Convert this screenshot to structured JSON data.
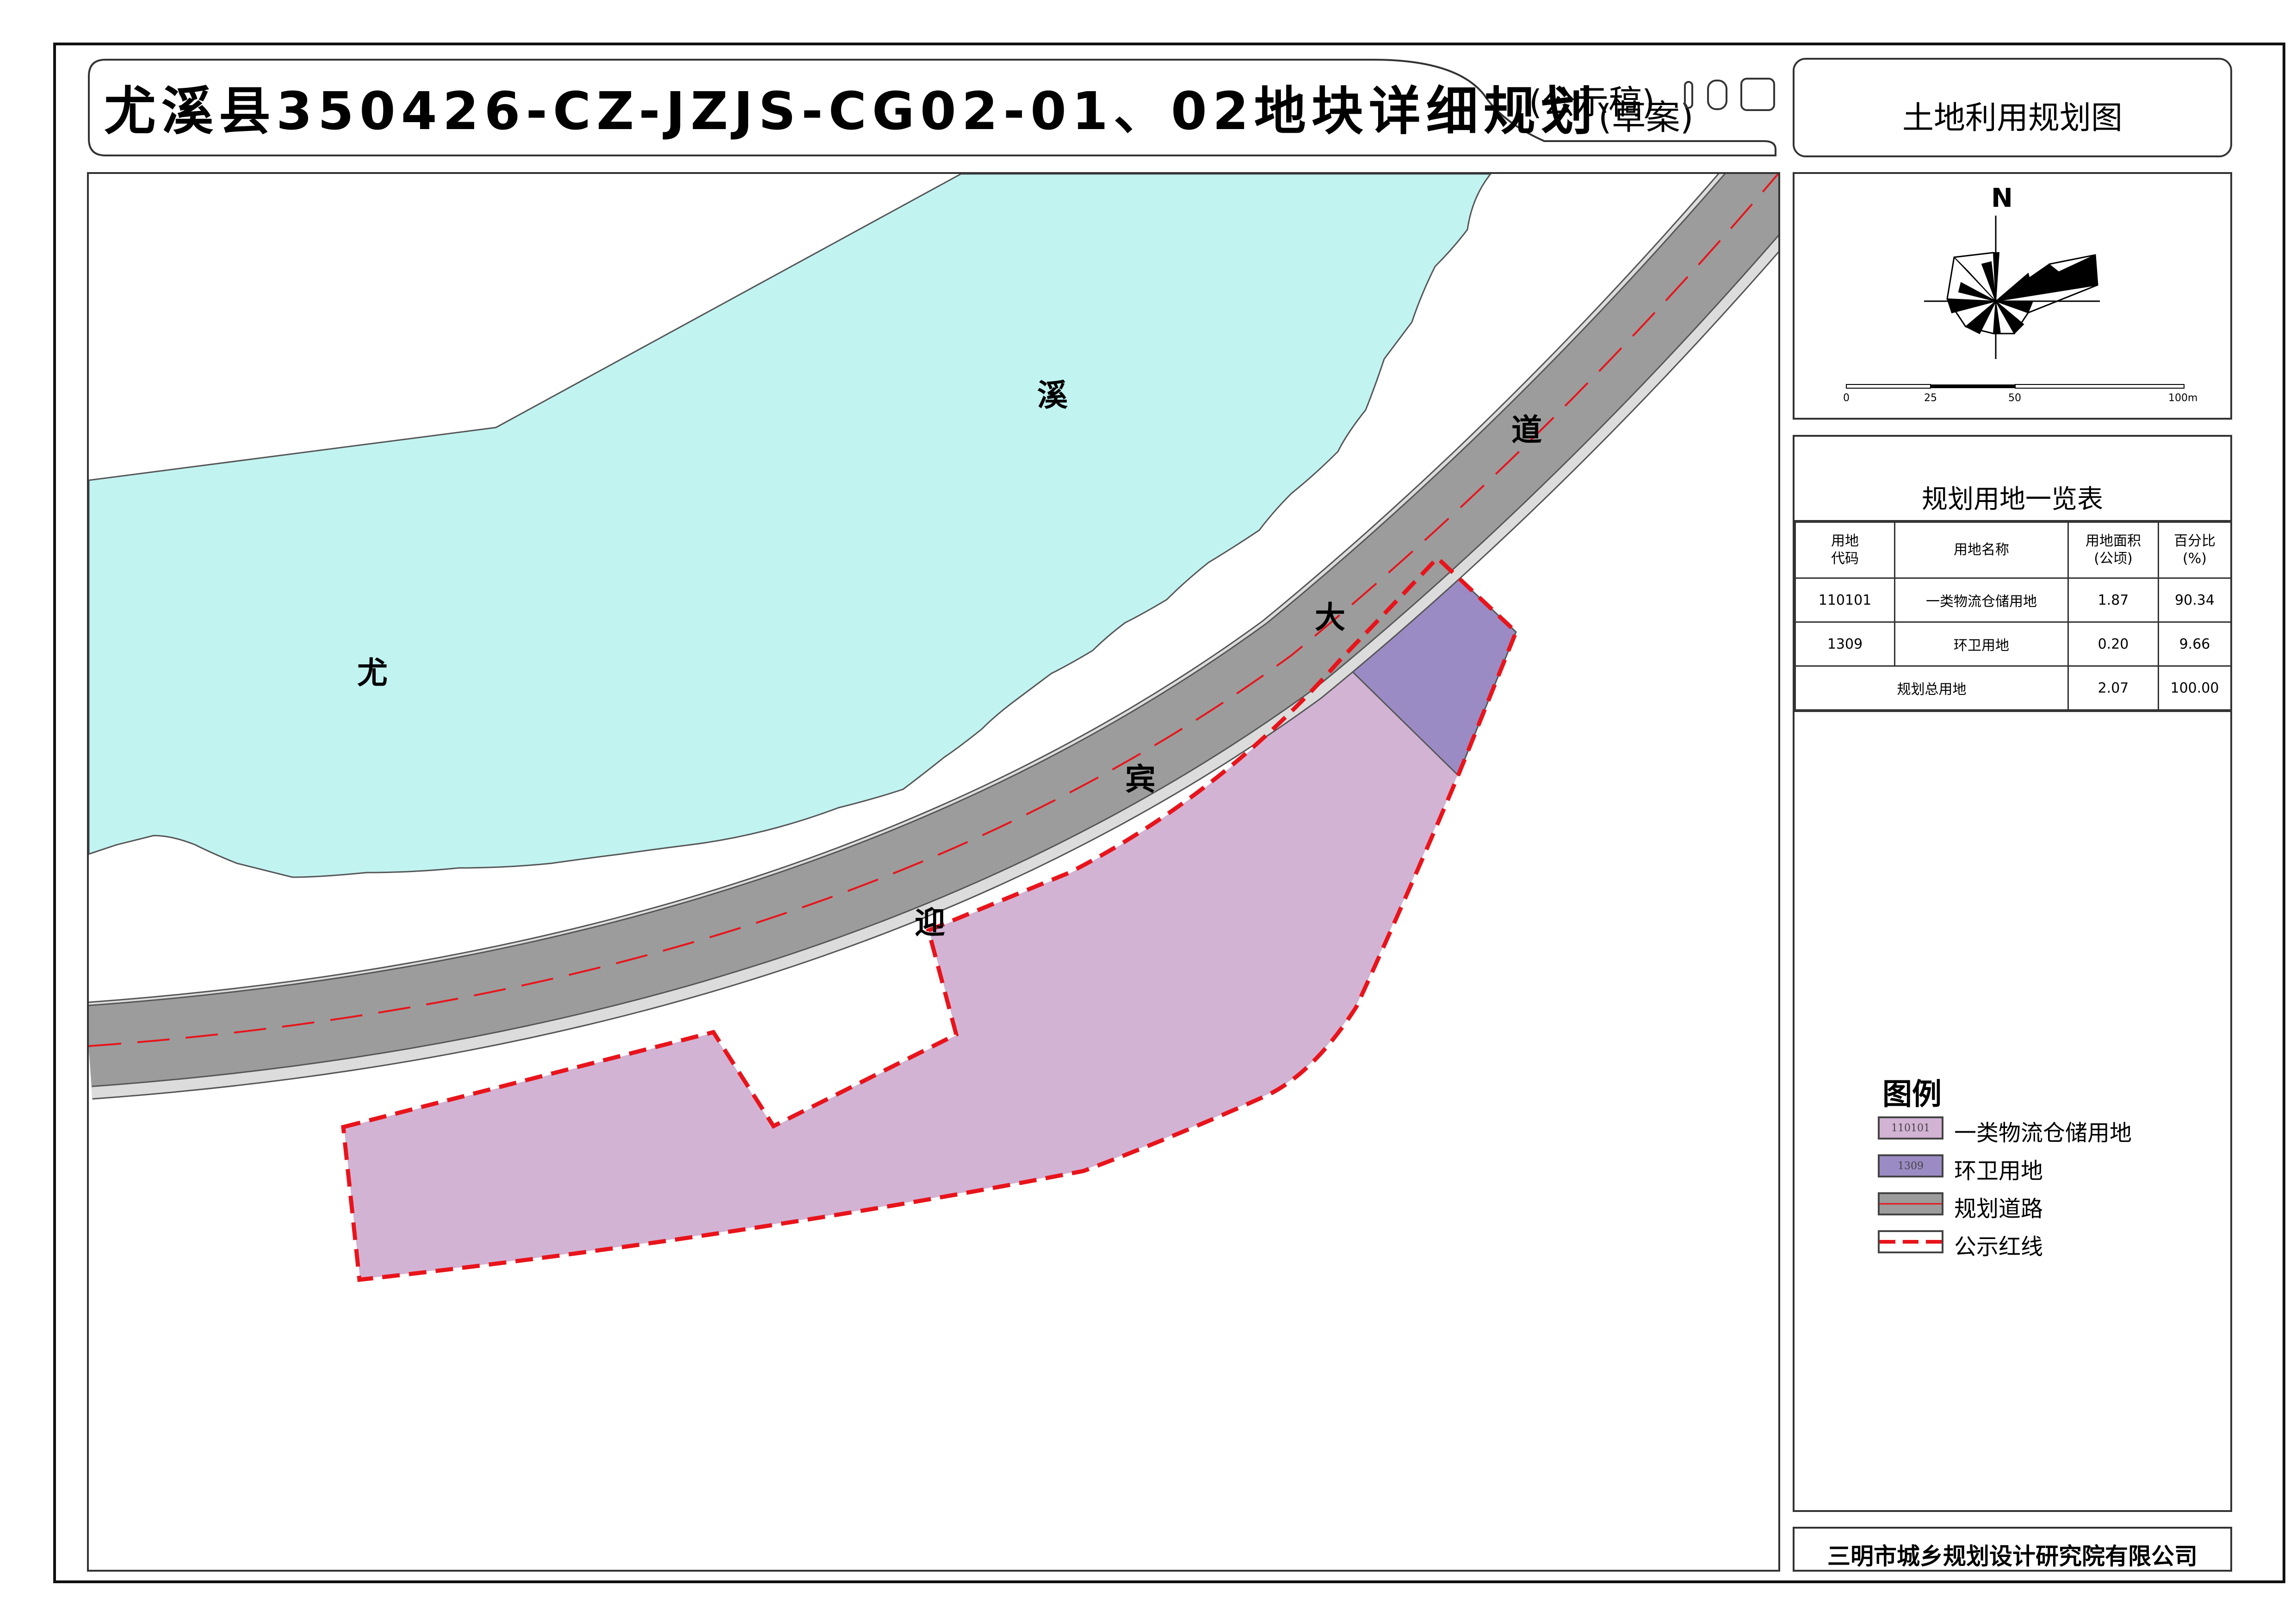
{
  "header": {
    "title_main": "尤溪县350426-CZ-JZJS-CG02-01、02地块详细规划",
    "title_suffix": "(草案)",
    "notice": "(公示稿)",
    "drawing_name": "土地利用规划图"
  },
  "map": {
    "labels": {
      "river_you": "尤",
      "river_xi": "溪",
      "road_ying": "迎",
      "road_bin": "宾",
      "road_da": "大",
      "road_dao": "道"
    },
    "colors": {
      "river": "#c1f3f1",
      "road": "#9c9c9c",
      "road_edge": "#d9d9d9",
      "logistics_land": "#d2b3d4",
      "sanitation_land": "#9b8bc4",
      "red_line": "#e8141b"
    }
  },
  "compass": {
    "north_label": "N",
    "scale_ticks": [
      "0",
      "25",
      "50",
      "100m"
    ]
  },
  "land_table": {
    "title": "规划用地一览表",
    "headers": [
      "用地\n代码",
      "用地名称",
      "用地面积\n(公顷)",
      "百分比\n(%)"
    ],
    "rows": [
      {
        "code": "110101",
        "name": "一类物流仓储用地",
        "area": "1.87",
        "percent": "90.34"
      },
      {
        "code": "1309",
        "name": "环卫用地",
        "area": "0.20",
        "percent": "9.66"
      }
    ],
    "total": {
      "label": "规划总用地",
      "area": "2.07",
      "percent": "100.00"
    }
  },
  "legend": {
    "title": "图例",
    "items": [
      {
        "code": "110101",
        "label": "一类物流仓储用地",
        "color": "#d2b3d4"
      },
      {
        "code": "1309",
        "label": "环卫用地",
        "color": "#9b8bc4"
      },
      {
        "code": "",
        "label": "规划道路",
        "color": "#9c9c9c"
      },
      {
        "code": "",
        "label": "公示红线",
        "color": "#e8141b"
      }
    ]
  },
  "footer": {
    "organization": "三明市城乡规划设计研究院有限公司"
  }
}
